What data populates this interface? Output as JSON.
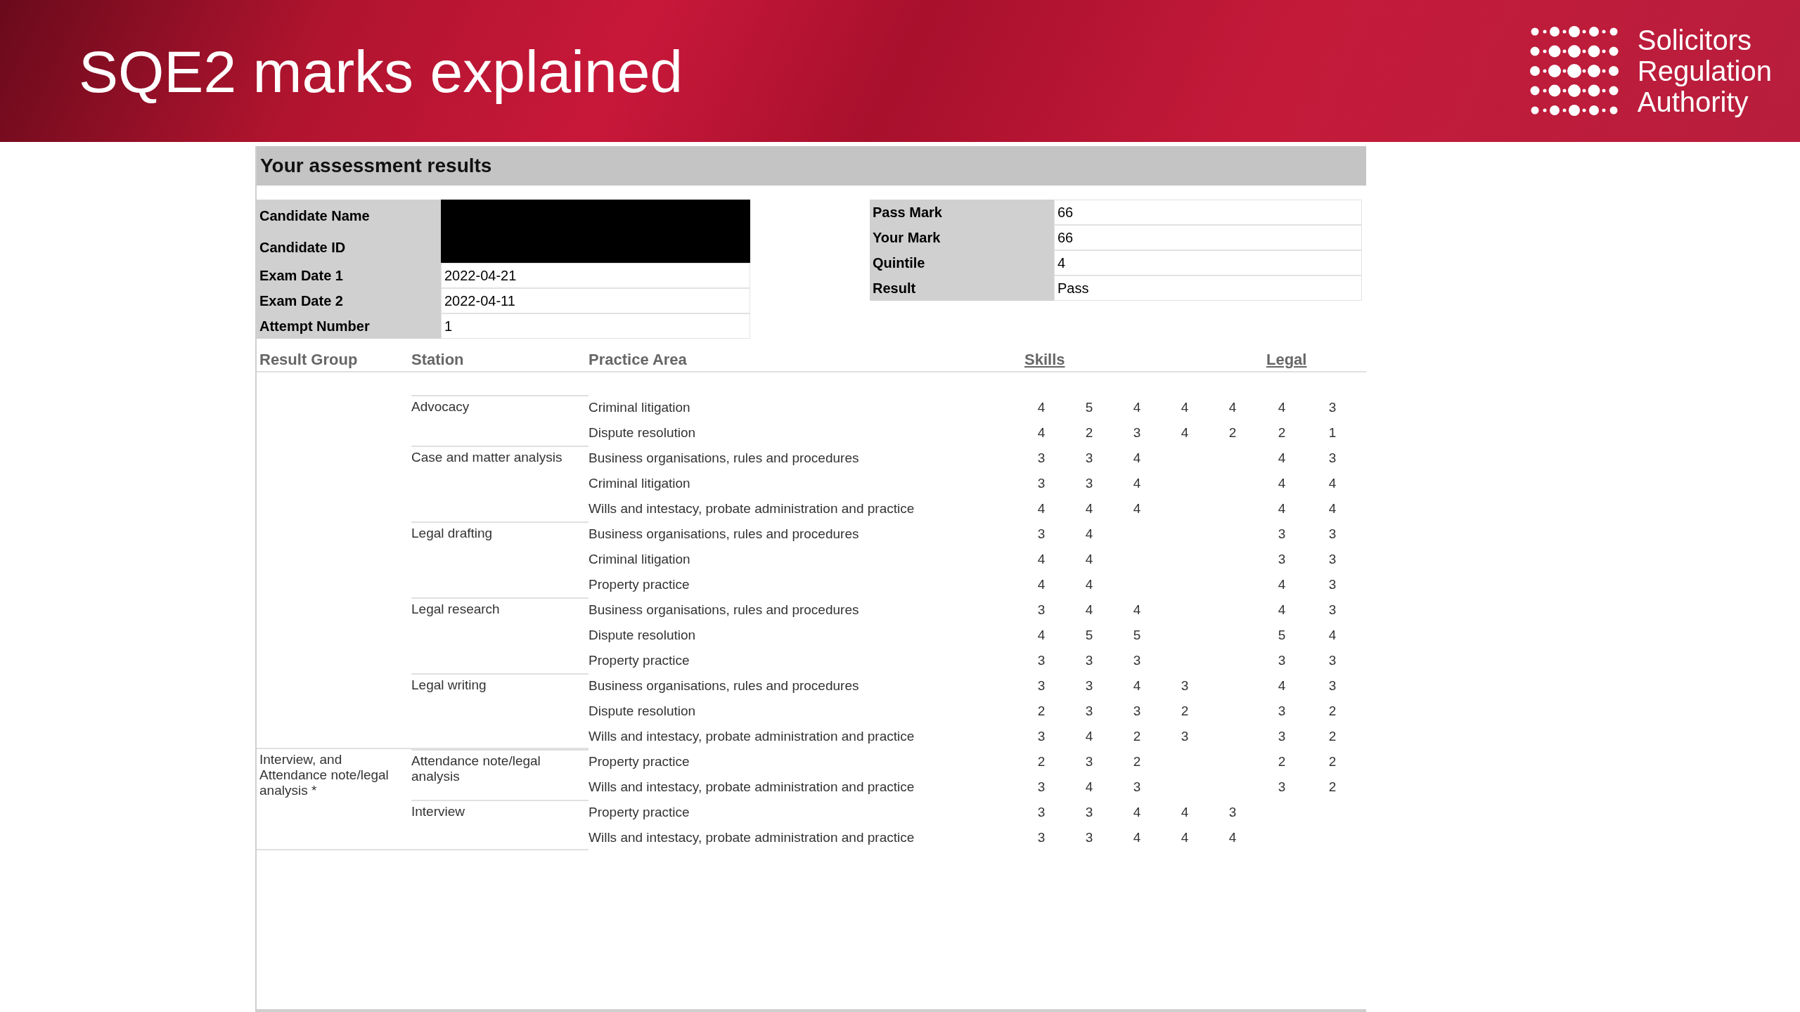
{
  "slide": {
    "title": "SQE2 marks explained",
    "logo_lines": [
      "Solicitors",
      "Regulation",
      "Authority"
    ]
  },
  "document": {
    "heading": "Your assessment results",
    "candidate_fields": [
      {
        "label": "Candidate Name",
        "redacted": true
      },
      {
        "label": "Candidate ID",
        "redacted": true
      },
      {
        "label": "Exam Date 1",
        "value": "2022-04-21"
      },
      {
        "label": "Exam Date 2",
        "value": "2022-04-11"
      },
      {
        "label": "Attempt Number",
        "value": "1"
      }
    ],
    "result_fields": [
      {
        "label": "Pass Mark",
        "value": "66"
      },
      {
        "label": "Your Mark",
        "value": "66"
      },
      {
        "label": "Quintile",
        "value": "4"
      },
      {
        "label": "Result",
        "value": "Pass"
      }
    ],
    "table": {
      "columns": [
        "Result Group",
        "Station",
        "Practice Area"
      ],
      "skills_heading": "Skills",
      "legal_heading": "Legal",
      "groups": [
        {
          "stations": [
            {
              "name": "Advocacy",
              "areas": [
                {
                  "name": "Criminal litigation",
                  "scores": {
                    "skill_1": "4",
                    "skill_2": "5",
                    "skill_3": "4",
                    "skill_4": "4",
                    "skill_5": "4",
                    "legal_1": "4",
                    "legal_2": "3"
                  }
                },
                {
                  "name": "Dispute resolution",
                  "scores": {
                    "skill_1": "4",
                    "skill_2": "2",
                    "skill_3": "3",
                    "skill_4": "4",
                    "skill_5": "2",
                    "legal_1": "2",
                    "legal_2": "1"
                  }
                }
              ]
            },
            {
              "name": "Case and matter analysis",
              "areas": [
                {
                  "name": "Business organisations, rules and procedures",
                  "scores": {
                    "skill_1": "3",
                    "skill_2": "3",
                    "skill_3": "4",
                    "legal_1": "4",
                    "legal_2": "3"
                  }
                },
                {
                  "name": "Criminal litigation",
                  "scores": {
                    "skill_1": "3",
                    "skill_2": "3",
                    "skill_3": "4",
                    "legal_1": "4",
                    "legal_2": "4"
                  }
                },
                {
                  "name": "Wills and intestacy, probate administration and practice",
                  "scores": {
                    "skill_1": "4",
                    "skill_2": "4",
                    "skill_3": "4",
                    "legal_1": "4",
                    "legal_2": "4"
                  }
                }
              ]
            },
            {
              "name": "Legal drafting",
              "areas": [
                {
                  "name": "Business organisations, rules and procedures",
                  "scores": {
                    "skill_1": "3",
                    "skill_2": "4",
                    "legal_1": "3",
                    "legal_2": "3"
                  }
                },
                {
                  "name": "Criminal litigation",
                  "scores": {
                    "skill_1": "4",
                    "skill_2": "4",
                    "legal_1": "3",
                    "legal_2": "3"
                  }
                },
                {
                  "name": "Property practice",
                  "scores": {
                    "skill_1": "4",
                    "skill_2": "4",
                    "legal_1": "4",
                    "legal_2": "3"
                  }
                }
              ]
            },
            {
              "name": "Legal research",
              "areas": [
                {
                  "name": "Business organisations, rules and procedures",
                  "scores": {
                    "skill_1": "3",
                    "skill_2": "4",
                    "skill_3": "4",
                    "legal_1": "4",
                    "legal_2": "3"
                  }
                },
                {
                  "name": "Dispute resolution",
                  "scores": {
                    "skill_1": "4",
                    "skill_2": "5",
                    "skill_3": "5",
                    "legal_1": "5",
                    "legal_2": "4"
                  }
                },
                {
                  "name": "Property practice",
                  "scores": {
                    "skill_1": "3",
                    "skill_2": "3",
                    "skill_3": "3",
                    "legal_1": "3",
                    "legal_2": "3"
                  }
                }
              ]
            },
            {
              "name": "Legal writing",
              "areas": [
                {
                  "name": "Business organisations, rules and procedures",
                  "scores": {
                    "skill_1": "3",
                    "skill_2": "3",
                    "skill_3": "4",
                    "skill_4": "3",
                    "legal_1": "4",
                    "legal_2": "3"
                  }
                },
                {
                  "name": "Dispute resolution",
                  "scores": {
                    "skill_1": "2",
                    "skill_2": "3",
                    "skill_3": "3",
                    "skill_4": "2",
                    "legal_1": "3",
                    "legal_2": "2"
                  }
                },
                {
                  "name": "Wills and intestacy, probate administration and practice",
                  "scores": {
                    "skill_1": "3",
                    "skill_2": "4",
                    "skill_3": "2",
                    "skill_4": "3",
                    "legal_1": "3",
                    "legal_2": "2"
                  }
                }
              ]
            }
          ]
        },
        {
          "name": "Interview, and Attendance note/legal analysis *",
          "stations": [
            {
              "name": "Attendance note/legal analysis",
              "areas": [
                {
                  "name": "Property practice",
                  "scores": {
                    "skill_1": "2",
                    "skill_2": "3",
                    "skill_3": "2",
                    "legal_1": "2",
                    "legal_2": "2"
                  }
                },
                {
                  "name": "Wills and intestacy, probate administration and practice",
                  "scores": {
                    "skill_1": "3",
                    "skill_2": "4",
                    "skill_3": "3",
                    "legal_1": "3",
                    "legal_2": "2"
                  }
                }
              ]
            },
            {
              "name": "Interview",
              "areas": [
                {
                  "name": "Property practice",
                  "scores": {
                    "skill_1": "3",
                    "skill_2": "3",
                    "skill_3": "4",
                    "skill_4": "4",
                    "skill_5": "3"
                  }
                },
                {
                  "name": "Wills and intestacy, probate administration and practice",
                  "scores": {
                    "skill_1": "3",
                    "skill_2": "3",
                    "skill_3": "4",
                    "skill_4": "4",
                    "skill_5": "4"
                  }
                }
              ]
            }
          ]
        }
      ]
    }
  }
}
